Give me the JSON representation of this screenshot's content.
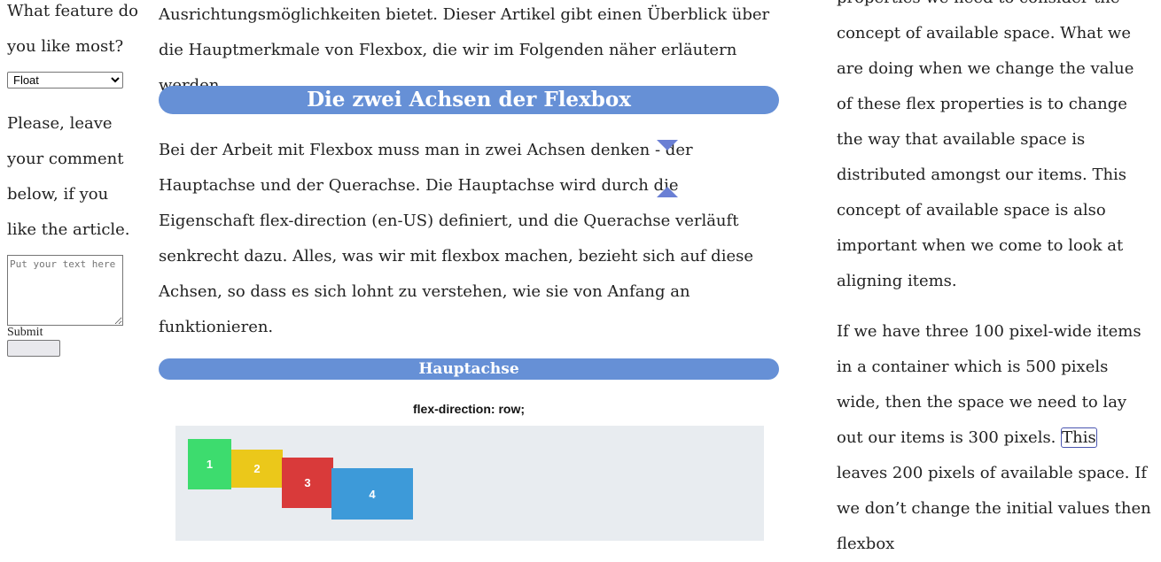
{
  "sidebar": {
    "question": "What feature do you like most?",
    "select_value": "Float",
    "comment_prompt": "Please, leave your comment below, if you like the article.",
    "textarea_placeholder": "Put your text here",
    "submit_label": "Submit"
  },
  "main": {
    "intro_text": "Ausrichtungsmöglichkeiten bietet. Dieser Artikel gibt einen Überblick über die Hauptmerkmale von Flexbox, die wir im Folgenden näher erläutern werden.",
    "heading": "Die zwei Achsen der Flexbox",
    "body_text": "Bei der Arbeit mit Flexbox muss man in zwei Achsen denken - der Hauptachse und der Querachse. Die Hauptachse wird durch die Eigenschaft flex-direction (en-US) definiert, und die Querachse verläuft senkrecht dazu. Alles, was wir mit flexbox machen, bezieht sich auf diese Achsen, so dass es sich lohnt zu verstehen, wie sie von Anfang an funktionieren.",
    "subheading": "Hauptachse",
    "figure": {
      "caption": "flex-direction: row;",
      "items": [
        {
          "label": "1",
          "color": "#3ddc6e"
        },
        {
          "label": "2",
          "color": "#ebc81a"
        },
        {
          "label": "3",
          "color": "#d93a3a"
        },
        {
          "label": "4",
          "color": "#3d9ad9"
        }
      ]
    }
  },
  "right": {
    "para1": "properties we need to consider the concept of available space. What we are doing when we change the value of these flex properties is to change the way that available space is distributed amongst our items. This concept of available space is also important when we come to look at aligning items.",
    "para2_before": "If we have three 100 pixel-wide items in a container which is 500 pixels wide, then the space we need to lay out our items is 300 pixels.",
    "para2_highlight": "This",
    "para2_after": "leaves 200 pixels of available space. If we don’t change the initial values then flexbox"
  },
  "colors": {
    "banner": "#6690d6",
    "marker": "#6a7fd4"
  }
}
